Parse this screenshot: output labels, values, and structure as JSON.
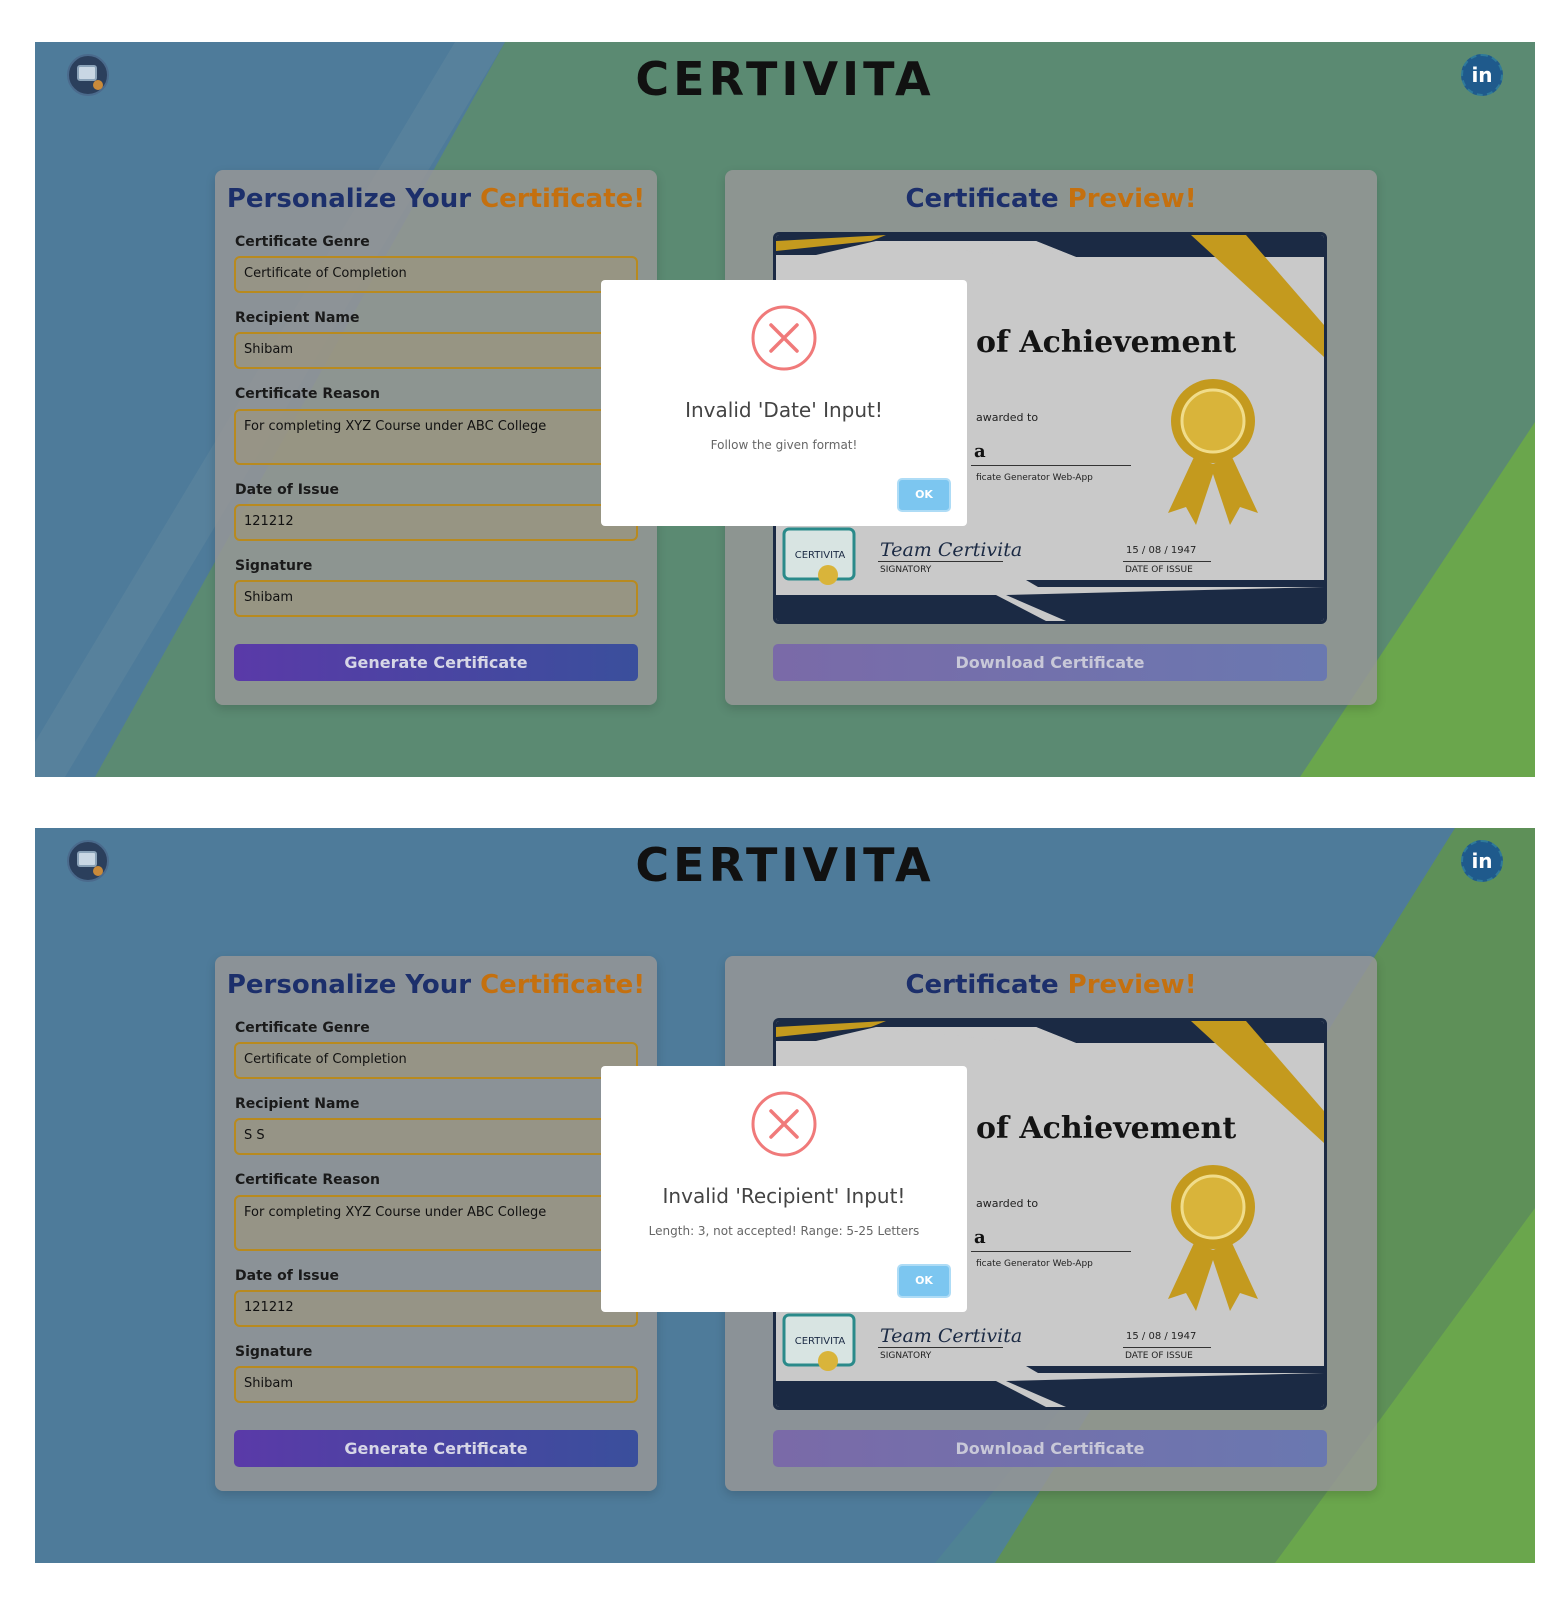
{
  "app": {
    "brand": "CERTIVITA",
    "linkedin_label": "in"
  },
  "form": {
    "title_main": "Personalize Your ",
    "title_accent": "Certificate!",
    "genre_label": "Certificate Genre",
    "recipient_label": "Recipient Name",
    "reason_label": "Certificate Reason",
    "date_label": "Date of Issue",
    "signature_label": "Signature",
    "generate_label": "Generate Certificate"
  },
  "preview": {
    "title_main": "Certificate ",
    "title_accent": "Preview!",
    "cert_title": "of Achievement",
    "awarded_text": "awarded to",
    "name_fragment": "a",
    "reason_fragment": "ficate Generator Web-App",
    "signature": "Team Certivita",
    "signatory_label": "SIGNATORY",
    "date": "15 / 08 / 1947",
    "date_label": "DATE OF ISSUE",
    "badge_text": "CERTIVITA",
    "download_label": "Download Certificate"
  },
  "screenshots": [
    {
      "genre_value": "Certificate of Completion",
      "recipient_value": "Shibam",
      "reason_value": "For completing XYZ Course under ABC College",
      "date_value": "121212",
      "signature_value": "Shibam",
      "modal": {
        "title": "Invalid 'Date' Input!",
        "text": "Follow the given format!",
        "ok_label": "OK"
      }
    },
    {
      "genre_value": "Certificate of Completion",
      "recipient_value": "S S",
      "reason_value": "For completing XYZ Course under ABC College",
      "date_value": "121212",
      "signature_value": "Shibam",
      "modal": {
        "title": "Invalid 'Recipient' Input!",
        "text": "Length: 3, not accepted! Range: 5-25 Letters",
        "ok_label": "OK"
      }
    }
  ],
  "colors": {
    "title_blue": "#1c2f6b",
    "title_orange": "#c4700f",
    "error_red": "#f07a7a",
    "ok_blue": "#7cc6f0"
  },
  "icons": {
    "logo": "certificate-magnifier-icon",
    "social": "linkedin-icon",
    "modal": "error-x-icon",
    "ribbon": "award-ribbon-icon"
  }
}
